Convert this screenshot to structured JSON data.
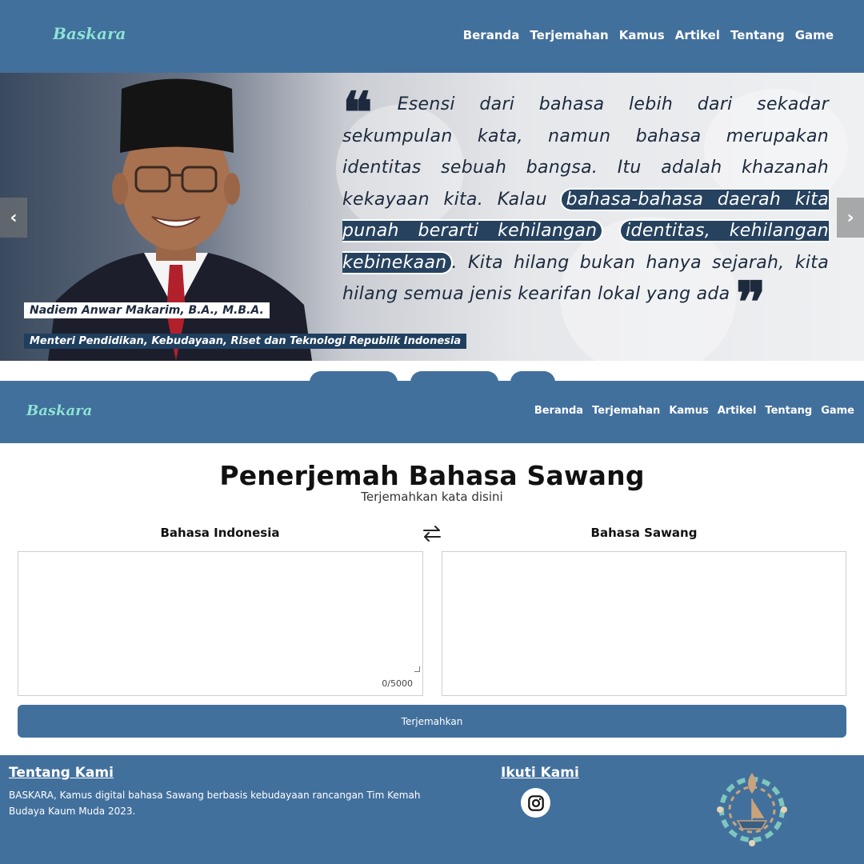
{
  "brand": {
    "logo_text": "Baskara"
  },
  "nav": {
    "items": [
      {
        "label": "Beranda"
      },
      {
        "label": "Terjemahan"
      },
      {
        "label": "Kamus"
      },
      {
        "label": "Artikel"
      },
      {
        "label": "Tentang"
      },
      {
        "label": "Game"
      }
    ]
  },
  "hero": {
    "quote_open": "❝",
    "quote_part1": "Esensi dari bahasa lebih dari sekadar sekumpulan kata, namun bahasa merupakan identitas sebuah bangsa. Itu adalah khazanah  kekayaan kita. Kalau",
    "quote_highlight1": "bahasa-bahasa daerah kita punah berarti kehilangan",
    "quote_highlight2": "identitas, kehilangan kebinekaan",
    "quote_part2": ". Kita hilang bukan hanya sejarah, kita hilang semua jenis kearifan lokal yang ada",
    "quote_close": "❞",
    "person_name": "Nadiem Anwar Makarim, B.A., M.B.A.",
    "person_title": "Menteri Pendidikan, Kebudayaan, Riset dan Teknologi Republik Indonesia",
    "prev_icon": "‹",
    "next_icon": "›"
  },
  "translator": {
    "title": "Penerjemah Bahasa Sawang",
    "subtitle": "Terjemahkan kata disini",
    "source_language": "Bahasa Indonesia",
    "target_language": "Bahasa Sawang",
    "input_value": "",
    "output_value": "",
    "char_counter": "0/5000",
    "translate_button": "Terjemahkan"
  },
  "footer": {
    "about_heading": "Tentang Kami",
    "about_text": "BASKARA, Kamus digital bahasa Sawang berbasis kebudayaan rancangan Tim Kemah Budaya Kaum Muda 2023.",
    "follow_heading": "Ikuti Kami",
    "social_icon": "instagram-icon"
  },
  "colors": {
    "nav_bg": "#42709d",
    "logo": "#8ee3d6",
    "highlight_bg": "#26425f",
    "text_dark": "#1d2a3e"
  }
}
